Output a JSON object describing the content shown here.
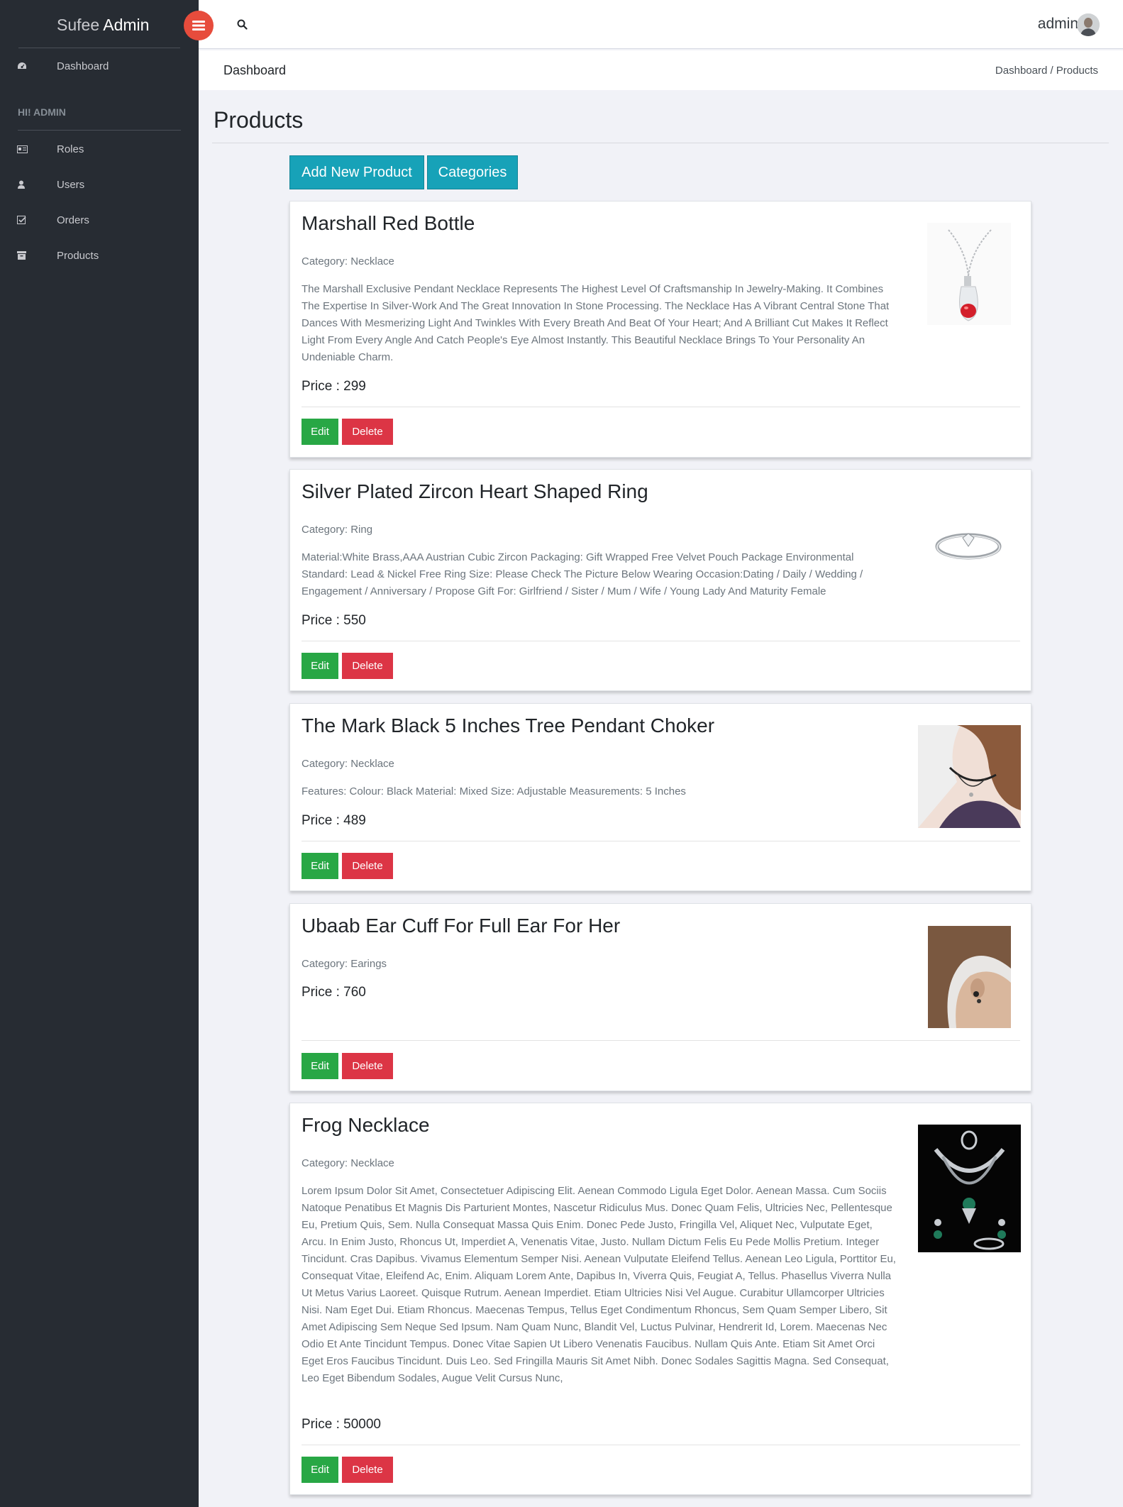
{
  "brand": {
    "part1": "Sufee",
    "part2": "Admin"
  },
  "sidebar": {
    "top_item": "Dashboard",
    "heading": "HI! ADMIN",
    "items": [
      {
        "label": "Roles",
        "icon": "id-card-icon"
      },
      {
        "label": "Users",
        "icon": "user-icon"
      },
      {
        "label": "Orders",
        "icon": "check-square-icon"
      },
      {
        "label": "Products",
        "icon": "archive-icon"
      }
    ]
  },
  "header": {
    "user": "admin"
  },
  "breadcrumb": {
    "title": "Dashboard",
    "path": "Dashboard / Products"
  },
  "page": {
    "title": "Products",
    "add_button": "Add New Product",
    "categories_button": "Categories"
  },
  "labels": {
    "edit": "Edit",
    "delete": "Delete"
  },
  "products": [
    {
      "title": "Marshall Red Bottle",
      "category": "Category: Necklace",
      "description": "The Marshall Exclusive Pendant Necklace Represents The Highest Level Of Craftsmanship In Jewelry-Making. It Combines The Expertise In Silver-Work And The Great Innovation In Stone Processing. The Necklace Has A Vibrant Central Stone That Dances With Mesmerizing Light And Twinkles With Every Breath And Beat Of Your Heart; And A Brilliant Cut Makes It Reflect Light From Every Angle And Catch People's Eye Almost Instantly. This Beautiful Necklace Brings To Your Personality An Undeniable Charm.",
      "price": "Price : 299"
    },
    {
      "title": "Silver Plated Zircon Heart Shaped Ring",
      "category": "Category: Ring",
      "description": "Material:White Brass,AAA Austrian Cubic Zircon Packaging: Gift Wrapped Free Velvet Pouch Package Environmental Standard: Lead & Nickel Free Ring Size: Please Check The Picture Below Wearing Occasion:Dating / Daily / Wedding / Engagement / Anniversary / Propose Gift For: Girlfriend / Sister / Mum / Wife / Young Lady And Maturity Female",
      "price": "Price : 550"
    },
    {
      "title": "The Mark Black 5 Inches Tree Pendant Choker",
      "category": "Category: Necklace",
      "description": "Features: Colour: Black Material: Mixed Size: Adjustable Measurements: 5 Inches",
      "price": "Price : 489"
    },
    {
      "title": "Ubaab Ear Cuff For Full Ear For Her",
      "category": "Category: Earings",
      "description": "",
      "price": "Price : 760"
    },
    {
      "title": "Frog Necklace",
      "category": "Category: Necklace",
      "description": "Lorem Ipsum Dolor Sit Amet, Consectetuer Adipiscing Elit. Aenean Commodo Ligula Eget Dolor. Aenean Massa. Cum Sociis Natoque Penatibus Et Magnis Dis Parturient Montes, Nascetur Ridiculus Mus. Donec Quam Felis, Ultricies Nec, Pellentesque Eu, Pretium Quis, Sem. Nulla Consequat Massa Quis Enim. Donec Pede Justo, Fringilla Vel, Aliquet Nec, Vulputate Eget, Arcu. In Enim Justo, Rhoncus Ut, Imperdiet A, Venenatis Vitae, Justo. Nullam Dictum Felis Eu Pede Mollis Pretium. Integer Tincidunt. Cras Dapibus. Vivamus Elementum Semper Nisi. Aenean Vulputate Eleifend Tellus. Aenean Leo Ligula, Porttitor Eu, Consequat Vitae, Eleifend Ac, Enim. Aliquam Lorem Ante, Dapibus In, Viverra Quis, Feugiat A, Tellus. Phasellus Viverra Nulla Ut Metus Varius Laoreet. Quisque Rutrum. Aenean Imperdiet. Etiam Ultricies Nisi Vel Augue. Curabitur Ullamcorper Ultricies Nisi. Nam Eget Dui. Etiam Rhoncus. Maecenas Tempus, Tellus Eget Condimentum Rhoncus, Sem Quam Semper Libero, Sit Amet Adipiscing Sem Neque Sed Ipsum. Nam Quam Nunc, Blandit Vel, Luctus Pulvinar, Hendrerit Id, Lorem. Maecenas Nec Odio Et Ante Tincidunt Tempus. Donec Vitae Sapien Ut Libero Venenatis Faucibus. Nullam Quis Ante. Etiam Sit Amet Orci Eget Eros Faucibus Tincidunt. Duis Leo. Sed Fringilla Mauris Sit Amet Nibh. Donec Sodales Sagittis Magna. Sed Consequat, Leo Eget Bibendum Sodales, Augue Velit Cursus Nunc,",
      "price": "Price : 50000"
    }
  ]
}
